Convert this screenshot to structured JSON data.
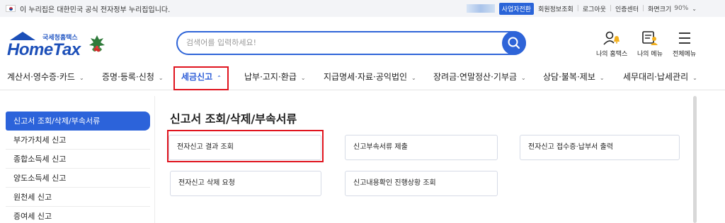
{
  "gov_banner": {
    "text": "이 누리집은 대한민국 공식 전자정부 누리집입니다.",
    "business_switch": "사업자전환",
    "links": [
      "회원정보조회",
      "로그아웃",
      "인증센터"
    ],
    "zoom_label": "화면크기",
    "zoom_value": "90%"
  },
  "logo": {
    "small_text": "국세청홈택스",
    "main_text": "HomeTax"
  },
  "search": {
    "placeholder": "검색어를 입력하세요!"
  },
  "utilities": {
    "my_hometax": "나의 홈택스",
    "my_menu": "나의 메뉴",
    "all_menu": "전체메뉴"
  },
  "nav": {
    "items": [
      "계산서·영수증·카드",
      "증명·등록·신청",
      "세금신고",
      "납부·고지·환급",
      "지급명세·자료·공익법인",
      "장려금·연말정산·기부금",
      "상담·불복·제보",
      "세무대리·납세관리"
    ],
    "active_index": 2
  },
  "sidebar": {
    "items": [
      "신고서 조회/삭제/부속서류",
      "부가가치세 신고",
      "종합소득세 신고",
      "양도소득세 신고",
      "원천세 신고",
      "증여세 신고"
    ],
    "active_index": 0
  },
  "main": {
    "title": "신고서 조회/삭제/부속서류",
    "cards": [
      "전자신고 결과 조회",
      "신고부속서류 제출",
      "전자신고 접수증·납부서 출력",
      "전자신고 삭제 요청",
      "신고내용확인 진행상황 조회"
    ]
  },
  "colors": {
    "brand_blue": "#2e64d8",
    "highlight_red": "#e0141e"
  }
}
